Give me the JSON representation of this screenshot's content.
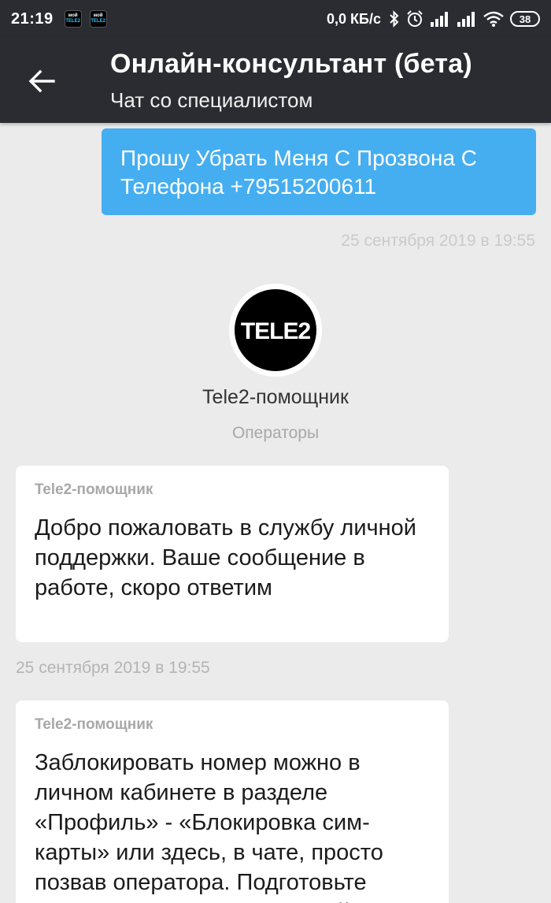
{
  "status_bar": {
    "time": "21:19",
    "notification_apps": [
      {
        "line1": "мой",
        "line2": "TELE2"
      },
      {
        "line1": "мой",
        "line2": "TELE2"
      }
    ],
    "net_speed": "0,0 КБ/с",
    "battery": "38"
  },
  "toolbar": {
    "title": "Онлайн-консультант (бета)",
    "subtitle": "Чат со специалистом"
  },
  "chat": {
    "outgoing_message": {
      "text": "Прошу Убрать Меня С Прозвона С Телефона +79515200611",
      "timestamp": "25 сентября 2019 в 19:55"
    },
    "agent": {
      "logo_text": "TELE2",
      "name": "Tele2-помощник",
      "role": "Операторы"
    },
    "incoming_messages": [
      {
        "sender": "Tele2-помощник",
        "text": "Добро пожаловать в службу личной поддержки. Ваше сообщение в работе, скоро ответим",
        "timestamp": "25 сентября 2019 в 19:55"
      },
      {
        "sender": "Tele2-помощник",
        "text": "Заблокировать номер можно в личном кабинете в разделе «Профиль» - «Блокировка сим-карты» или здесь, в чате, просто позвав оператора. Подготовьте паспортные данные, пожалуйста"
      }
    ]
  },
  "colors": {
    "toolbar_bg": "#2a2c31",
    "outgoing_bubble": "#45aef0",
    "chat_bg": "#ebebeb"
  }
}
